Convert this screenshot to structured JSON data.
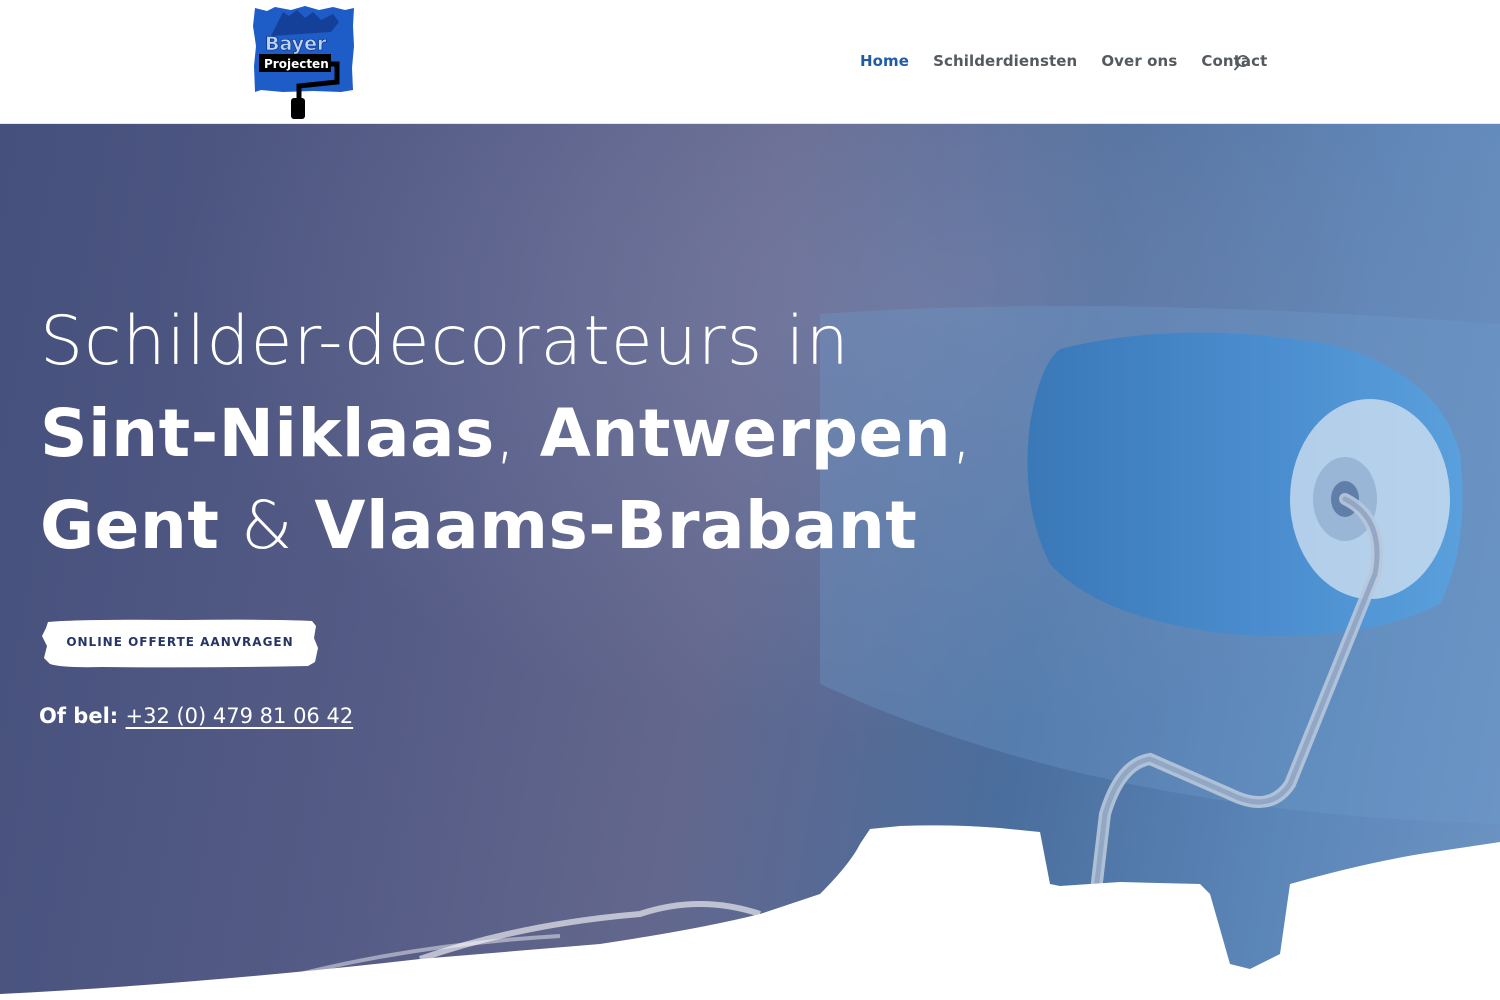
{
  "brand": {
    "logo_line1": "Bayer",
    "logo_line2": "Projecten",
    "colors": {
      "logo_blue": "#1e5cc8",
      "nav_active": "#1f5ba7",
      "nav_text": "#555a61",
      "cta_text": "#263566"
    }
  },
  "nav": {
    "items": [
      {
        "label": "Home",
        "active": true
      },
      {
        "label": "Schilderdiensten",
        "active": false
      },
      {
        "label": "Over ons",
        "active": false
      },
      {
        "label": "Contact",
        "active": false
      }
    ],
    "search_icon": "search-icon"
  },
  "hero": {
    "line1": "Schilder-decorateurs in",
    "city1": "Sint-Niklaas",
    "comma1": ",",
    "city2": "Antwerpen",
    "comma2": ",",
    "city3": "Gent",
    "amp": " & ",
    "city4": "Vlaams-Brabant",
    "cta_label": "ONLINE OFFERTE AANVRAGEN",
    "phone_prefix": "Of bel",
    "phone_colon": ": ",
    "phone_number": "+32 (0) 479 81 06 42"
  }
}
